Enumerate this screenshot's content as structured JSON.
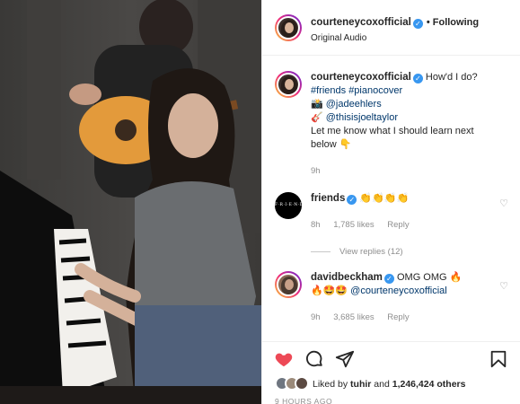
{
  "post": {
    "author": "courteneycoxofficial",
    "follow_status": "• Following",
    "audio": "Original Audio"
  },
  "caption": {
    "username": "courteneycoxofficial",
    "text": "How'd I do?",
    "hashtags": "#friends #pianocover",
    "line2_emoji": "📸",
    "line2_mention": "@jadeehlers",
    "line3_emoji": "🎸",
    "line3_mention": "@thisisjoeltaylor",
    "line4": "Let me know what I should learn next below",
    "line4_emoji": "👇",
    "time": "9h"
  },
  "comments": [
    {
      "username": "friends",
      "avatar_text": "F·R·I·E·N·D·S",
      "text": "👏👏👏👏",
      "time": "8h",
      "likes": "1,785 likes",
      "reply": "Reply",
      "view_replies": "View replies (12)"
    },
    {
      "username": "davidbeckham",
      "text": "OMG OMG 🔥",
      "text2": "🔥🤩🤩",
      "mention": "@courteneycoxofficial",
      "time": "9h",
      "likes": "3,685 likes",
      "reply": "Reply"
    }
  ],
  "actions": {
    "liked_by_prefix": "Liked by",
    "liked_by_user": "tuhir",
    "liked_by_and": "and",
    "like_count": "1,246,424 others",
    "timestamp": "9 HOURS AGO"
  },
  "icons": {
    "like": "heart-filled-icon",
    "comment": "comment-icon",
    "share": "paper-plane-icon",
    "save": "bookmark-icon",
    "verified": "verified-badge-icon"
  },
  "colors": {
    "like_red": "#ed4956",
    "link_blue": "#00376b",
    "verified_blue": "#3897f0",
    "muted": "#8e8e8e"
  }
}
